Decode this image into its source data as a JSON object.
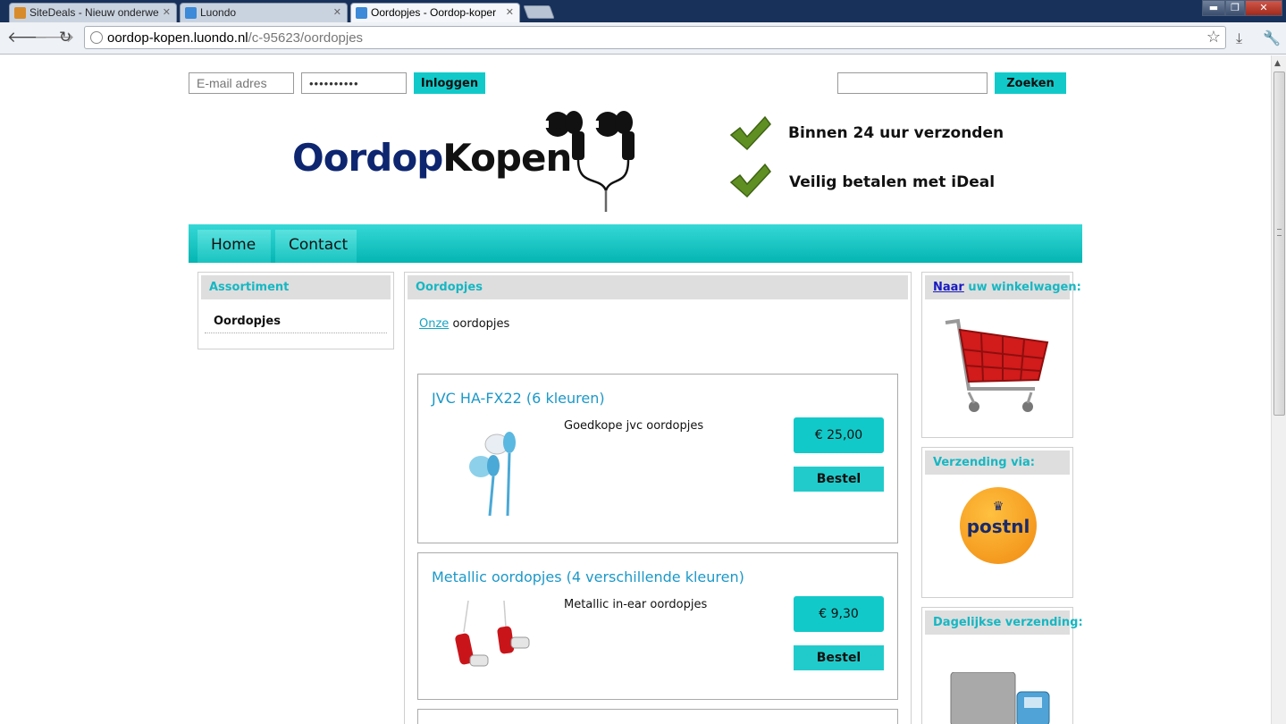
{
  "browser": {
    "tabs": [
      {
        "title": "SiteDeals - Nieuw onderwe",
        "active": false,
        "favicon": "sitedeals-icon"
      },
      {
        "title": "Luondo",
        "active": false,
        "favicon": "cart-icon"
      },
      {
        "title": "Oordopjes - Oordop-koper",
        "active": true,
        "favicon": "cart-icon"
      }
    ],
    "url_host": "oordop-kopen.luondo.nl",
    "url_path": "/c-95623/oordopjes",
    "window_controls": {
      "minimize": "▬",
      "maximize": "❐",
      "close": "✕"
    }
  },
  "header": {
    "email_placeholder": "E-mail adres",
    "password_value": "••••••••••",
    "login_label": "Inloggen",
    "search_label": "Zoeken",
    "logo_part1": "Oordop",
    "logo_part2": "Kopen",
    "usps": [
      "Binnen 24 uur verzonden",
      "Veilig betalen met iDeal"
    ]
  },
  "nav": {
    "items": [
      "Home",
      "Contact"
    ]
  },
  "sidebar_left": {
    "title": "Assortiment",
    "items": [
      "Oordopjes"
    ]
  },
  "main": {
    "title": "Oordopjes",
    "intro_link": "Onze",
    "intro_text": "oordopjes",
    "products": [
      {
        "name": "JVC HA-FX22 (6 kleuren)",
        "description": "Goedkope jvc oordopjes",
        "price": "€ 25,00",
        "order_label": "Bestel"
      },
      {
        "name": "Metallic oordopjes (4 verschillende kleuren)",
        "description": "Metallic in-ear oordopjes",
        "price": "€ 9,30",
        "order_label": "Bestel"
      }
    ]
  },
  "sidebar_right": {
    "cart_link": "Naar",
    "cart_text": "uw winkelwagen:",
    "shipping_title": "Verzending via:",
    "postnl_logo_text": "postnl",
    "daily_title": "Dagelijkse verzending:"
  },
  "colors": {
    "accent": "#12c9c9",
    "heading_teal": "#17b7c2",
    "logo_blue": "#0e2670",
    "product_title": "#1c98c8"
  }
}
